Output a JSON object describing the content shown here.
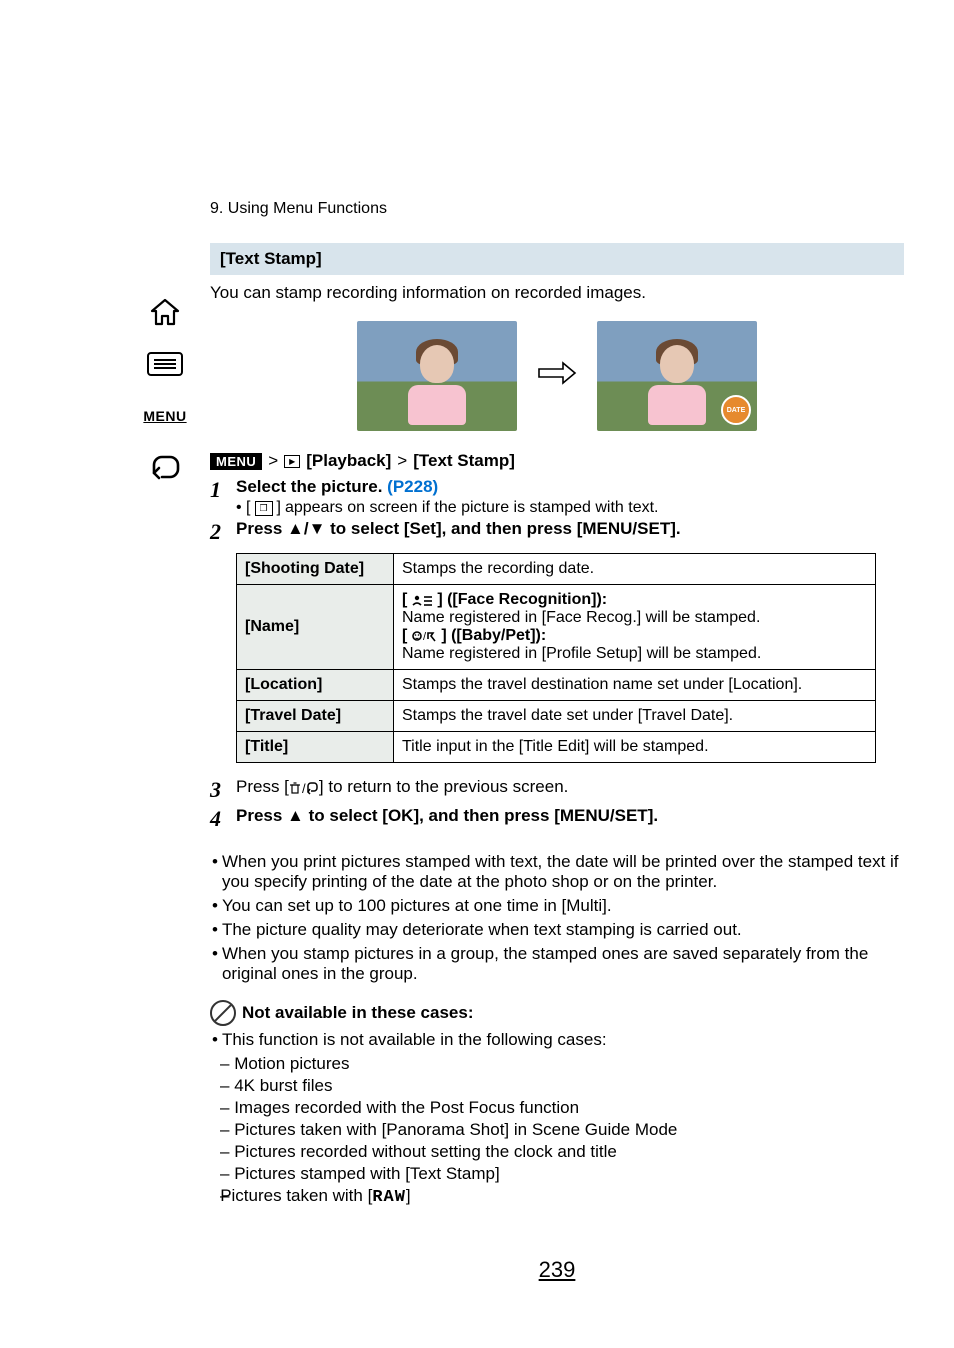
{
  "header": {
    "chapter": "9. Using Menu Functions"
  },
  "feature": {
    "title": "[Text Stamp]",
    "intro": "You can stamp recording information on recorded images.",
    "dateBadge": "DATE"
  },
  "menuPath": {
    "menu": "MENU",
    "arrow1": ">",
    "playback": "[Playback]",
    "arrow2": ">",
    "target": "[Text Stamp]"
  },
  "steps": {
    "s1": {
      "num": "1",
      "text": "Select the picture. ",
      "link": "(P228)",
      "sub": " appears on screen if the picture is stamped with text."
    },
    "s2": {
      "num": "2",
      "text": "Press ▲/▼ to select [Set], and then press [MENU/SET]."
    },
    "s3": {
      "num": "3",
      "text": "Press [",
      "text2": "] to return to the previous screen."
    },
    "s4": {
      "num": "4",
      "text": "Press ▲ to select [OK], and then press [MENU/SET]."
    }
  },
  "table": {
    "r1": {
      "label": "[Shooting Date]",
      "desc": "Stamps the recording date."
    },
    "r2": {
      "label": "[Name]",
      "line1a": "[",
      "line1b": "] ([Face Recognition]):",
      "line2": "Name registered in [Face Recog.] will be stamped.",
      "line3a": "[",
      "line3b": "] ([Baby/Pet]):",
      "line4": "Name registered in [Profile Setup] will be stamped."
    },
    "r3": {
      "label": "[Location]",
      "desc": "Stamps the travel destination name set under [Location]."
    },
    "r4": {
      "label": "[Travel Date]",
      "desc": "Stamps the travel date set under [Travel Date]."
    },
    "r5": {
      "label": "[Title]",
      "desc": "Title input in the [Title Edit] will be stamped."
    }
  },
  "notes": {
    "n1": "When you print pictures stamped with text, the date will be printed over the stamped text if you specify printing of the date at the photo shop or on the printer.",
    "n2": "You can set up to 100 pictures at one time in [Multi].",
    "n3": "The picture quality may deteriorate when text stamping is carried out.",
    "n4": "When you stamp pictures in a group, the stamped ones are saved separately from the original ones in the group."
  },
  "na": {
    "heading": "Not available in these cases:",
    "intro": "This function is not available in the following cases:",
    "i1": "Motion pictures",
    "i2": "4K burst files",
    "i3": "Images recorded with the Post Focus function",
    "i4": "Pictures taken with [Panorama Shot] in Scene Guide Mode",
    "i5": "Pictures recorded without setting the clock and title",
    "i6": "Pictures stamped with [Text Stamp]",
    "i7a": "Pictures taken with [",
    "i7raw": "RAW",
    "i7b": "]"
  },
  "pageNumber": "239"
}
